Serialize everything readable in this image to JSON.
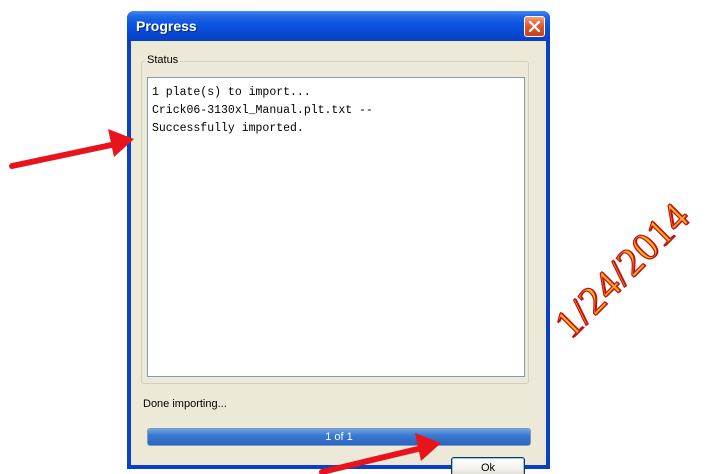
{
  "window": {
    "title": "Progress"
  },
  "status_group": {
    "label": "Status",
    "lines": [
      "1 plate(s) to import...",
      "Crick06-3130xl_Manual.plt.txt --",
      "Successfully imported."
    ]
  },
  "footer": {
    "done_text": "Done importing...",
    "progress_text": "1 of 1",
    "progress_fraction": 1.0,
    "ok_label": "Ok"
  },
  "annotation": {
    "date_text": "1/24/2014",
    "arrow_color": "#e8141c"
  },
  "icons": {
    "close": "close-icon"
  },
  "colors": {
    "titlebar": "#0a54e0",
    "window_face": "#ece9d8",
    "progress_fill": "#3b78d0"
  }
}
